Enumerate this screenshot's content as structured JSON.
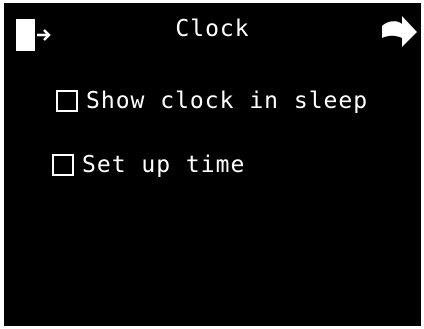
{
  "header": {
    "title": "Clock",
    "exit_icon": "exit-door-icon",
    "back_icon": "back-arrow-icon"
  },
  "options": [
    {
      "label": "Show clock in sleep",
      "checked": false
    },
    {
      "label": "Set up time",
      "checked": false
    }
  ],
  "colors": {
    "background": "#000000",
    "foreground": "#ffffff"
  }
}
